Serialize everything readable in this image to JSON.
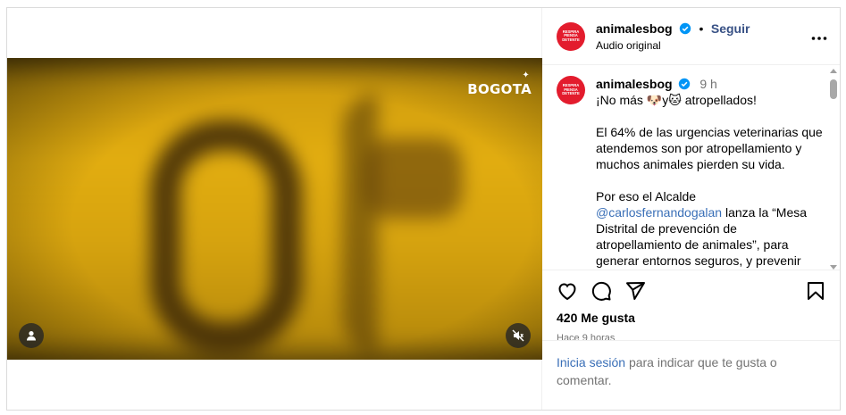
{
  "video": {
    "watermark": "BOGOTA",
    "user_icon": "user-icon",
    "mute_icon": "muted-speaker-icon"
  },
  "header": {
    "avatar_text": "RESPIRA PIENSA DETENTE",
    "username": "animalesbog",
    "separator": "•",
    "follow_label": "Seguir",
    "audio": "Audio original",
    "more_icon": "more-horizontal-icon"
  },
  "caption": {
    "username": "animalesbog",
    "time": "9 h",
    "line1": "¡No más 🐶y🐱 atropellados!",
    "para1": "El 64% de las urgencias veterinarias que atendemos son por atropellamiento y muchos animales pierden su vida.",
    "para2_prefix": "Por eso el Alcalde",
    "mention": "@carlosfernandogalan",
    "para2_suffix": "lanza la “Mesa Distrital de prevención de atropellamiento de animales”, para generar entornos seguros, y prevenir accidentes y mortalidad de animales"
  },
  "actions": {
    "like_icon": "heart-icon",
    "comment_icon": "comment-icon",
    "share_icon": "send-icon",
    "save_icon": "bookmark-icon",
    "likes": "420 Me gusta",
    "ago": "Hace 9 horas"
  },
  "login": {
    "link": "Inicia sesión",
    "text": "para indicar que te gusta o comentar."
  },
  "colors": {
    "brand_red": "#e31c2d",
    "link_blue": "#3a6fb7",
    "muted_text": "#737373"
  }
}
